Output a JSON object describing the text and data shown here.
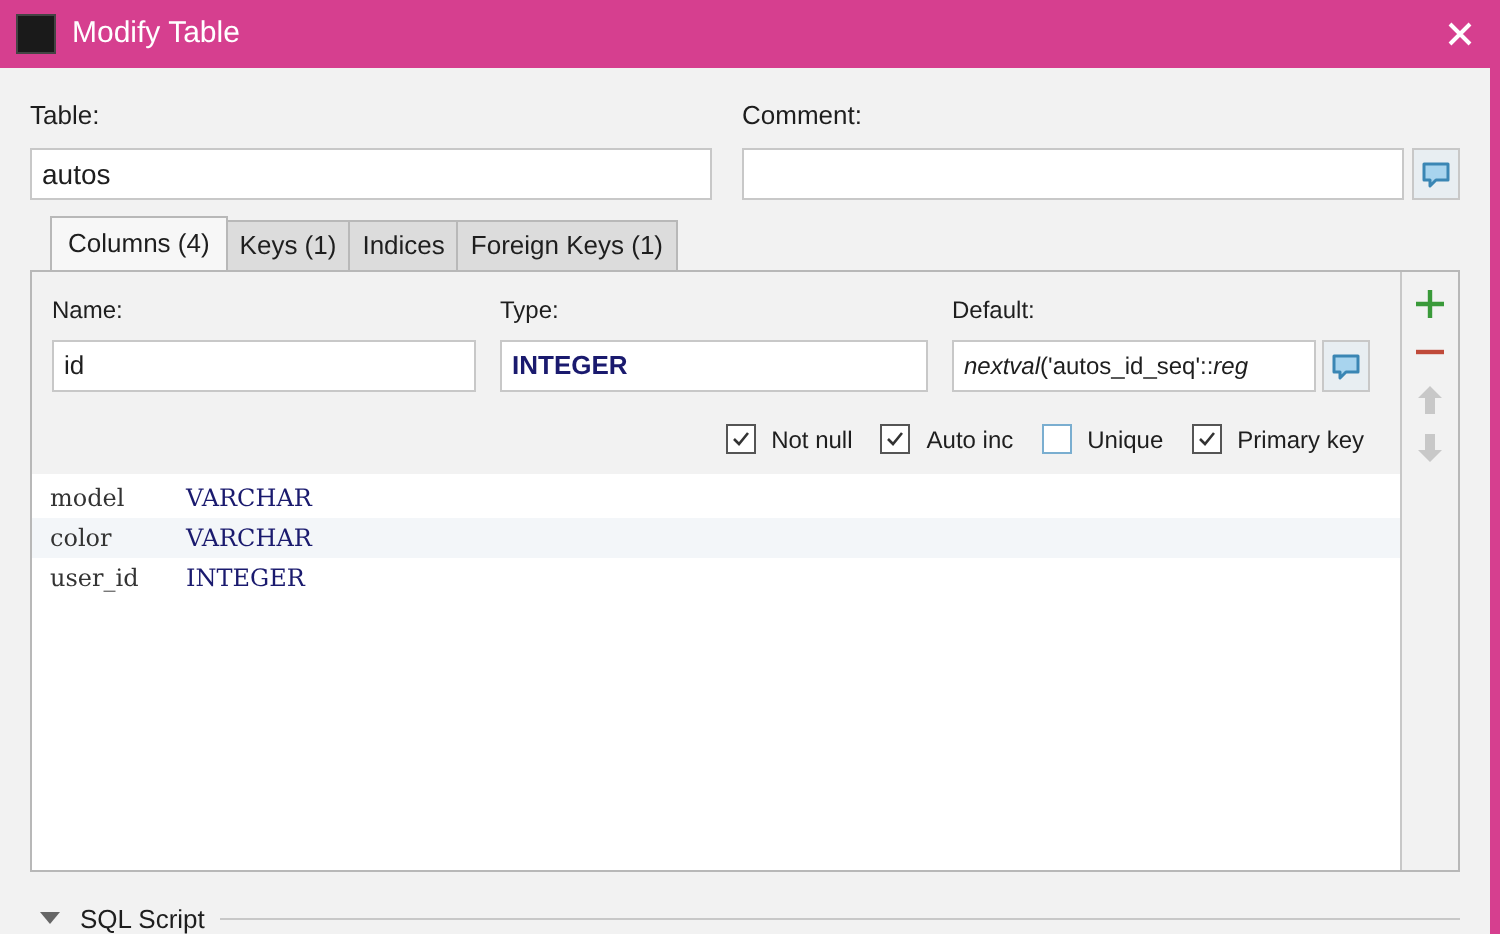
{
  "window": {
    "title": "Modify Table"
  },
  "table_field": {
    "label": "Table:",
    "value": "autos"
  },
  "comment_field": {
    "label": "Comment:"
  },
  "tabs": [
    {
      "label": "Columns (4)",
      "selected": true
    },
    {
      "label": "Keys (1)",
      "selected": false
    },
    {
      "label": "Indices",
      "selected": false
    },
    {
      "label": "Foreign Keys (1)",
      "selected": false
    }
  ],
  "column_editor": {
    "name": {
      "label": "Name:",
      "value": "id"
    },
    "type": {
      "label": "Type:",
      "value": "INTEGER"
    },
    "default": {
      "label": "Default:",
      "value": "*nextval*('autos_id_seq'::*reg*"
    },
    "options": [
      {
        "label": "Not null",
        "checked": true
      },
      {
        "label": "Auto inc",
        "checked": true
      },
      {
        "label": "Unique",
        "checked": false
      },
      {
        "label": "Primary key",
        "checked": true
      }
    ]
  },
  "columns": [
    {
      "name": "model",
      "type": "VARCHAR"
    },
    {
      "name": "color",
      "type": "VARCHAR"
    },
    {
      "name": "user_id",
      "type": "INTEGER"
    }
  ],
  "sql_section": {
    "label": "SQL Script",
    "expanded": true
  }
}
